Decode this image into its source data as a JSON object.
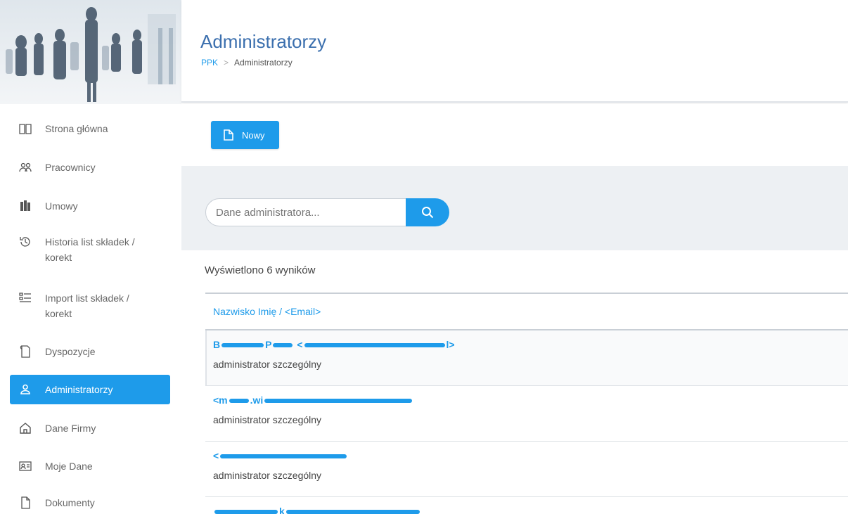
{
  "sidebar": {
    "items": [
      {
        "label": "Strona główna",
        "icon": "book-icon",
        "active": false
      },
      {
        "label": "Pracownicy",
        "icon": "users-icon",
        "active": false
      },
      {
        "label": "Umowy",
        "icon": "documents-icon",
        "active": false
      },
      {
        "label": "Historia list składek / korekt",
        "icon": "history-icon",
        "active": false
      },
      {
        "label": "Import list składek / korekt",
        "icon": "import-list-icon",
        "active": false
      },
      {
        "label": "Dyspozycje",
        "icon": "dispositions-icon",
        "active": false
      },
      {
        "label": "Administratorzy",
        "icon": "user-icon",
        "active": true
      },
      {
        "label": "Dane Firmy",
        "icon": "home-icon",
        "active": false
      },
      {
        "label": "Moje Dane",
        "icon": "id-card-icon",
        "active": false
      },
      {
        "label": "Dokumenty",
        "icon": "file-icon",
        "active": false
      }
    ]
  },
  "header": {
    "title": "Administratorzy",
    "breadcrumb": {
      "root": "PPK",
      "separator": ">",
      "current": "Administratorzy"
    }
  },
  "toolbar": {
    "new_label": "Nowy"
  },
  "search": {
    "placeholder": "Dane administratora...",
    "value": ""
  },
  "results": {
    "count_text": "Wyświetlono 6 wyników",
    "column_header": "Nazwisko Imię / <Email>",
    "rows": [
      {
        "title_visible_start": "B",
        "title_visible_mid": "P",
        "title_visible_end": "l>",
        "role": "administrator szczególny"
      },
      {
        "title_visible_start": "<m",
        "title_visible_mid": ".wi",
        "title_visible_end": "",
        "role": "administrator szczególny"
      },
      {
        "title_visible_start": "<",
        "title_visible_mid": "",
        "title_visible_end": "",
        "role": "administrator szczególny"
      },
      {
        "title_visible_start": "",
        "title_visible_mid": "k",
        "title_visible_end": "",
        "role": ""
      }
    ]
  },
  "colors": {
    "accent": "#1e9bea",
    "title": "#3b6fae",
    "band": "#edf0f3"
  }
}
